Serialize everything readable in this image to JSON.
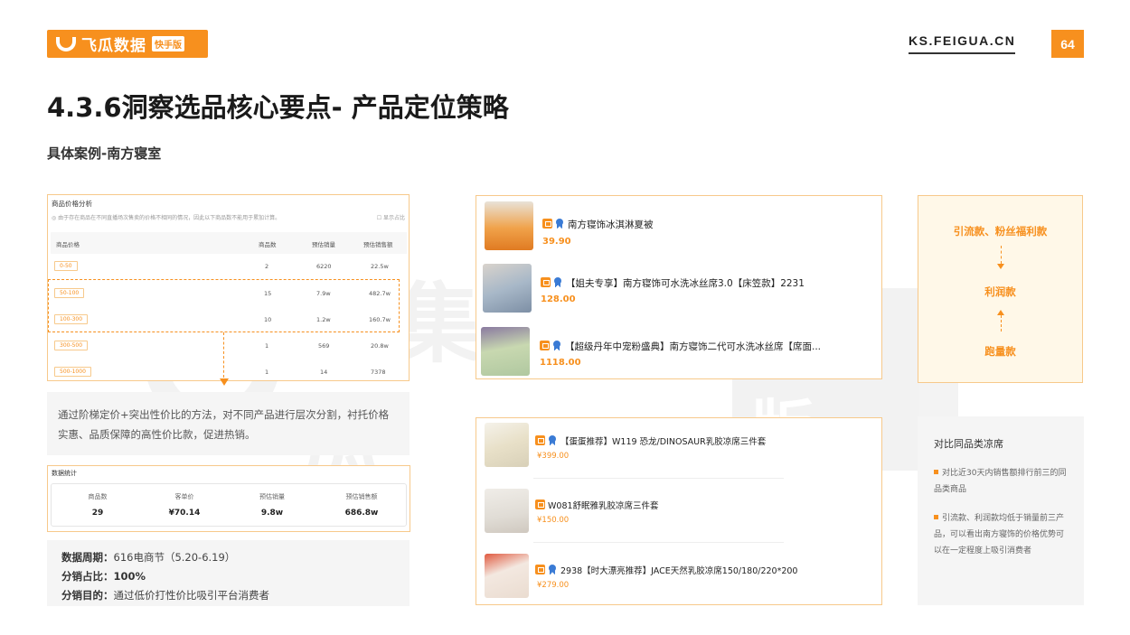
{
  "header": {
    "logo_text": "飞瓜数据",
    "logo_badge": "快手版",
    "site": "KS.FEIGUA.CN",
    "page_number": "64",
    "accent_color": "#f7901e"
  },
  "title": "4.3.6洞察选品核心要点- 产品定位策略",
  "subtitle": "具体案例-南方寝室",
  "watermark": {
    "text": "果集·飞瓜",
    "badge": "快手版"
  },
  "price_analysis": {
    "title": "商品价格分析",
    "note": "由于存在商品在不同直播场次售卖的价格不相同的情况，因此以下商品数不能用于累加计算。",
    "toggle_label": "显示占比",
    "columns": [
      "商品价格",
      "商品数",
      "预估销量",
      "预估销售额"
    ],
    "rows": [
      {
        "range": "0-50",
        "count": "2",
        "sales": "6220",
        "revenue": "22.5w"
      },
      {
        "range": "50-100",
        "count": "15",
        "sales": "7.9w",
        "revenue": "482.7w"
      },
      {
        "range": "100-300",
        "count": "10",
        "sales": "1.2w",
        "revenue": "160.7w"
      },
      {
        "range": "300-500",
        "count": "1",
        "sales": "569",
        "revenue": "20.8w"
      },
      {
        "range": "500-1000",
        "count": "1",
        "sales": "14",
        "revenue": "7378"
      }
    ]
  },
  "description": "通过阶梯定价+突出性价比的方法，对不同产品进行层次分割，衬托价格实惠、品质保障的高性价比款，促进热销。",
  "data_stats": {
    "title": "数据统计",
    "items": [
      {
        "label": "商品数",
        "value": "29"
      },
      {
        "label": "客单价",
        "value": "¥70.14"
      },
      {
        "label": "预估销量",
        "value": "9.8w"
      },
      {
        "label": "预估销售额",
        "value": "686.8w"
      }
    ]
  },
  "period": {
    "line1_label": "数据周期：",
    "line1_value": "616电商节（5.20-6.19）",
    "line2_label": "分销占比：",
    "line2_value": "100%",
    "line3_label": "分销目的：",
    "line3_value": "通过低价打性价比吸引平台消费者"
  },
  "products_top": [
    {
      "name": "南方寝饰冰淇淋夏被",
      "price": "39.90"
    },
    {
      "name": "【姐夫专享】南方寝饰可水洗冰丝席3.0【床笠款】2231",
      "price": "128.00"
    },
    {
      "name": "【超级丹年中宠粉盛典】南方寝饰二代可水洗冰丝席【席面...",
      "price": "1118.00"
    }
  ],
  "products_compare": [
    {
      "name": "【蛋蛋推荐】W119 恐龙/DINOSAUR乳胶凉席三件套",
      "price": "¥399.00"
    },
    {
      "name": "W081舒眠雅乳胶凉席三件套",
      "price": "¥150.00"
    },
    {
      "name": "2938【时大漂亮推荐】JACE天然乳胶凉席150/180/220*200",
      "price": "¥279.00"
    }
  ],
  "flow": {
    "top": "引流款、粉丝福利款",
    "middle": "利润款",
    "bottom": "跑量款"
  },
  "compare": {
    "title": "对比同品类凉席",
    "point1": "对比近30天内销售额排行前三的同品类商品",
    "point2": "引流款、利润款均低于销量前三产品，可以看出南方寝饰的价格优势可以在一定程度上吸引消费者"
  }
}
